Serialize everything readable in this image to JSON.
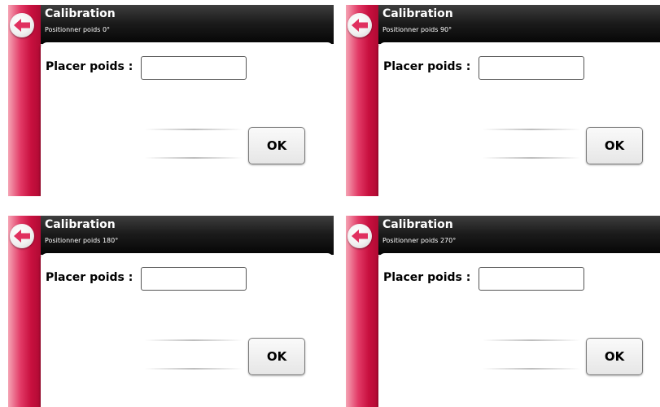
{
  "screens": [
    {
      "title": "Calibration",
      "subtitle": "Positionner poids 0°",
      "label": "Placer poids :",
      "input_value": "",
      "ok_label": "OK"
    },
    {
      "title": "Calibration",
      "subtitle": "Positionner poids 90°",
      "label": "Placer poids :",
      "input_value": "",
      "ok_label": "OK"
    },
    {
      "title": "Calibration",
      "subtitle": "Positionner poids 180°",
      "label": "Placer poids :",
      "input_value": "",
      "ok_label": "OK"
    },
    {
      "title": "Calibration",
      "subtitle": "Positionner poids 270°",
      "label": "Placer poids :",
      "input_value": "",
      "ok_label": "OK"
    }
  ],
  "icons": {
    "back": "back-arrow-icon"
  },
  "colors": {
    "accent": "#e0305f",
    "header": "#111111",
    "arrow": "#e0305f"
  }
}
